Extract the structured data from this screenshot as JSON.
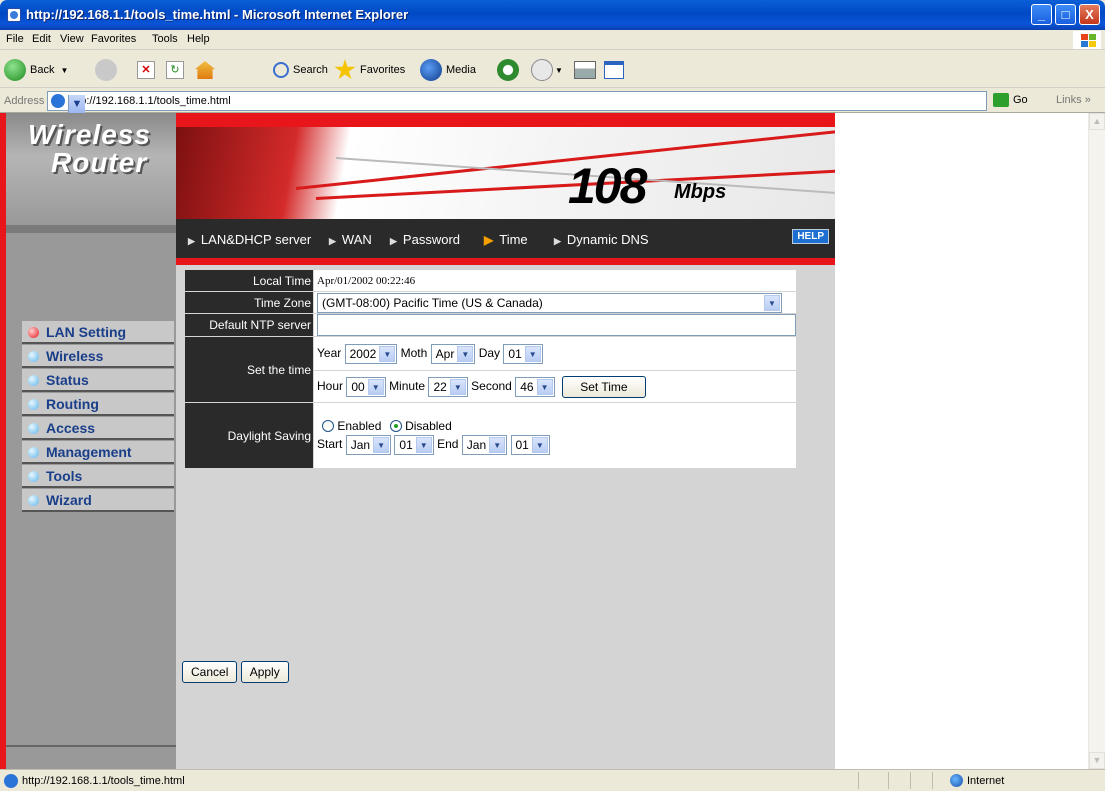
{
  "window": {
    "title": "http://192.168.1.1/tools_time.html - Microsoft Internet Explorer",
    "minimize": "_",
    "maximize": "□",
    "close": "X"
  },
  "menu": [
    "File",
    "Edit",
    "View",
    "Favorites",
    "Tools",
    "Help"
  ],
  "toolbar": {
    "back": "Back",
    "search": "Search",
    "favorites": "Favorites",
    "media": "Media"
  },
  "address": {
    "label": "Address",
    "url": "http://192.168.1.1/tools_time.html",
    "go": "Go",
    "links": "Links »"
  },
  "sidebar": {
    "brand_line1": "Wireless",
    "brand_line2": "Router",
    "items": [
      {
        "label": "LAN Setting"
      },
      {
        "label": "Wireless"
      },
      {
        "label": "Status"
      },
      {
        "label": "Routing"
      },
      {
        "label": "Access"
      },
      {
        "label": "Management"
      },
      {
        "label": "Tools"
      },
      {
        "label": "Wizard"
      }
    ]
  },
  "header": {
    "speed": "108",
    "unit": "Mbps",
    "help": "HELP",
    "nav": [
      "LAN&DHCP server",
      "WAN",
      "Password",
      "Time",
      "Dynamic DNS"
    ]
  },
  "form": {
    "local_time_label": "Local Time",
    "local_time_value": "Apr/01/2002 00:22:46",
    "time_zone_label": "Time Zone",
    "time_zone_value": "(GMT-08:00) Pacific Time (US & Canada)",
    "ntp_label": "Default NTP server",
    "ntp_value": "",
    "set_time_label": "Set the time",
    "year_label": "Year",
    "year_value": "2002",
    "month_label": "Moth",
    "month_value": "Apr",
    "day_label": "Day",
    "day_value": "01",
    "hour_label": "Hour",
    "hour_value": "00",
    "minute_label": "Minute",
    "minute_value": "22",
    "second_label": "Second",
    "second_value": "46",
    "set_time_button": "Set Time",
    "daylight_label": "Daylight Saving",
    "enabled_label": "Enabled",
    "disabled_label": "Disabled",
    "start_label": "Start",
    "start_month": "Jan",
    "start_day": "01",
    "end_label": "End",
    "end_month": "Jan",
    "end_day": "01"
  },
  "actions": {
    "cancel": "Cancel",
    "apply": "Apply"
  },
  "status": {
    "text": "http://192.168.1.1/tools_time.html",
    "zone": "Internet"
  }
}
